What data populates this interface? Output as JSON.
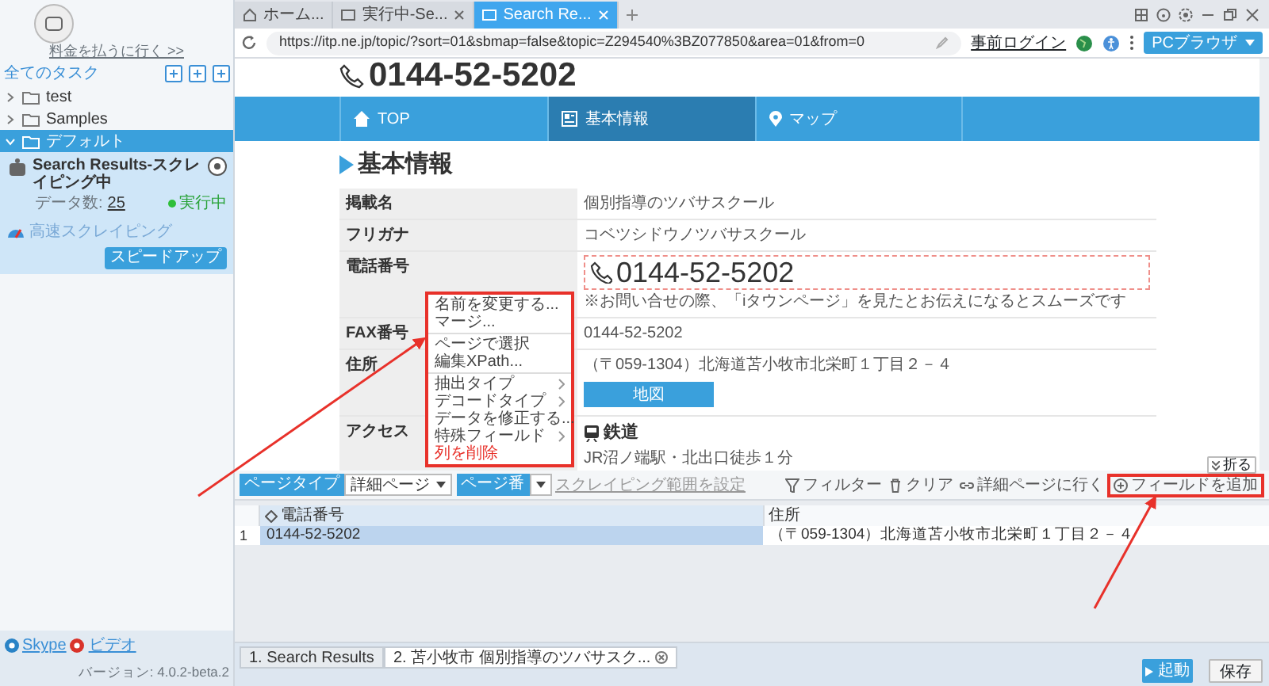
{
  "sidebar": {
    "upgrade_link": "料金を払うに行く >>",
    "all_tasks": "全てのタスク",
    "folders": [
      {
        "label": "test",
        "expanded": false,
        "selected": false
      },
      {
        "label": "Samples",
        "expanded": false,
        "selected": false
      },
      {
        "label": "デフォルト",
        "expanded": true,
        "selected": true
      }
    ],
    "task": {
      "title": "Search Results-スクレイピング中",
      "count_label": "データ数:",
      "count": "25",
      "status": "実行中",
      "mode": "高速スクレイピング",
      "speed_button": "スピードアップ"
    },
    "footer_links": [
      "Skype",
      "ビデオ"
    ],
    "version": "バージョン: 4.0.2-beta.2"
  },
  "browser": {
    "tabs": [
      {
        "label": "ホーム...",
        "selected": false,
        "kind": "home"
      },
      {
        "label": "実行中-Se...",
        "selected": false,
        "kind": "page"
      },
      {
        "label": "Search Re...",
        "selected": true,
        "kind": "page"
      }
    ],
    "url": "https://itp.ne.jp/topic/?sort=01&sbmap=false&topic=Z294540%3BZ077850&area=01&from=0",
    "login": "事前ログイン",
    "browser_mode": "PCブラウザ"
  },
  "page": {
    "header_phone": "0144-52-5202",
    "nav": [
      {
        "label": "TOP",
        "selected": false,
        "kind": "home"
      },
      {
        "label": "基本情報",
        "selected": true,
        "kind": "info"
      },
      {
        "label": "マップ",
        "selected": false,
        "kind": "map"
      }
    ],
    "heading": "基本情報",
    "rows": [
      {
        "kind": "text",
        "label": "掲載名",
        "value": "個別指導のツバサスクール"
      },
      {
        "kind": "text",
        "label": "フリガナ",
        "value": "コベツシドウノツバサスクール"
      },
      {
        "kind": "phone",
        "label": "電話番号",
        "value": "0144-52-5202",
        "note": "※お問い合せの際、「iタウンページ」を見たとお伝えになるとスムーズです"
      },
      {
        "kind": "text",
        "label": "FAX番号",
        "value": "0144-52-5202"
      },
      {
        "kind": "address",
        "label": "住所",
        "value": "（〒059-1304）北海道苫小牧市北栄町１丁目２－４",
        "button": "地図"
      },
      {
        "kind": "access",
        "label": "アクセス",
        "subheading": "鉄道",
        "value": "JR沼ノ端駅・北出口徒歩１分"
      }
    ]
  },
  "context_menu": [
    [
      {
        "label": "名前を変更する...",
        "kind": "item"
      },
      {
        "label": "マージ...",
        "kind": "item"
      }
    ],
    [
      {
        "label": "ページで選択",
        "kind": "item"
      },
      {
        "label": "編集XPath...",
        "kind": "item"
      }
    ],
    [
      {
        "label": "抽出タイプ",
        "kind": "submenu"
      },
      {
        "label": "デコードタイプ",
        "kind": "submenu"
      },
      {
        "label": "データを修正する...",
        "kind": "item"
      },
      {
        "label": "特殊フィールド",
        "kind": "submenu"
      },
      {
        "label": "列を削除",
        "kind": "danger"
      }
    ]
  ],
  "data_panel": {
    "page_type_label": "ページタイプ",
    "page_type_value": "詳細ページ",
    "page_number_label": "ページ番",
    "range_link": "スクレイピング範囲を設定",
    "tools": [
      {
        "label": "フィルター",
        "kind": "filter",
        "highlighted": false
      },
      {
        "label": "クリア",
        "kind": "clear",
        "highlighted": false
      },
      {
        "label": "詳細ページに行く",
        "kind": "link",
        "highlighted": false
      },
      {
        "label": "フィールドを追加",
        "kind": "add",
        "highlighted": true
      }
    ],
    "collapse": "折る",
    "columns": [
      "電話番号",
      "住所"
    ],
    "rows": [
      {
        "index": "1",
        "selected": true,
        "cells": [
          "0144-52-5202",
          "（〒059-1304）北海道苫小牧市北栄町１丁目２－４"
        ]
      }
    ]
  },
  "result_tabs": [
    {
      "label": "1. Search Results",
      "selected": false
    },
    {
      "label": "2. 苫小牧市 個別指導のツバサスク...",
      "selected": true
    }
  ],
  "actions": {
    "start": "起動",
    "save": "保存"
  }
}
